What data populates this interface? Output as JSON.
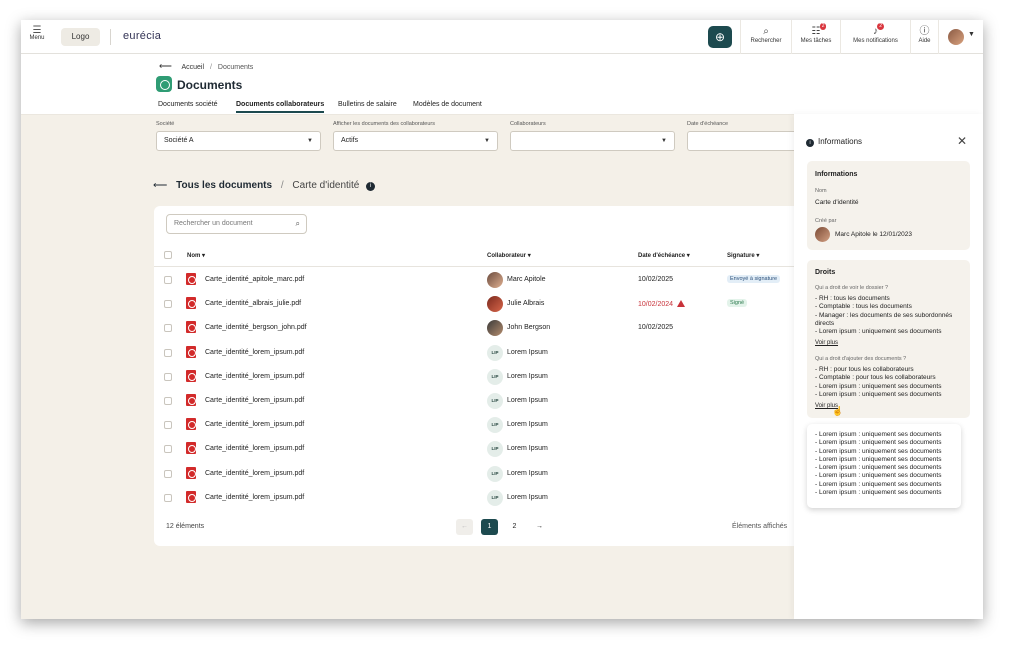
{
  "topbar": {
    "menu_label": "Menu",
    "logo_label": "Logo",
    "brand": "eurécia",
    "search_label": "Rechercher",
    "tasks_label": "Mes tâches",
    "tasks_badge": "2",
    "notifications_label": "Mes notifications",
    "notifications_badge": "2",
    "help_label": "Aide"
  },
  "breadcrumb": {
    "home": "Accueil",
    "separator": "/",
    "current": "Documents"
  },
  "page_title": "Documents",
  "tabs": [
    {
      "label": "Documents société",
      "active": false
    },
    {
      "label": "Documents collaborateurs",
      "active": true
    },
    {
      "label": "Bulletins de salaire",
      "active": false
    },
    {
      "label": "Modèles de document",
      "active": false
    }
  ],
  "filters": {
    "company": {
      "label": "Société",
      "value": "Société A"
    },
    "show_docs": {
      "label": "Afficher les documents des collaborateurs",
      "value": "Actifs"
    },
    "collaborators": {
      "label": "Collaborateurs",
      "value": ""
    },
    "due_date": {
      "label": "Date d'échéance",
      "value": ""
    }
  },
  "content": {
    "back_title": "Tous les documents",
    "separator": "/",
    "folder": "Carte d'identité"
  },
  "table": {
    "search_placeholder": "Rechercher un document",
    "headers": {
      "name": "Nom",
      "collaborator": "Collaborateur",
      "due": "Date d'échéance",
      "signature": "Signature"
    },
    "rows": [
      {
        "file": "Carte_identité_apitole_marc.pdf",
        "collaborator": "Marc Apitole",
        "initials": "",
        "due": "10/02/2025",
        "overdue": false,
        "signature": "Envoyé à signature"
      },
      {
        "file": "Carte_identité_albrais_julie.pdf",
        "collaborator": "Julie Albrais",
        "initials": "",
        "due": "10/02/2024",
        "overdue": true,
        "signature": "Signé"
      },
      {
        "file": "Carte_identité_bergson_john.pdf",
        "collaborator": "John Bergson",
        "initials": "",
        "due": "10/02/2025",
        "overdue": false,
        "signature": ""
      },
      {
        "file": "Carte_identité_lorem_ipsum.pdf",
        "collaborator": "Lorem Ipsum",
        "initials": "LIP",
        "due": "",
        "overdue": false,
        "signature": ""
      },
      {
        "file": "Carte_identité_lorem_ipsum.pdf",
        "collaborator": "Lorem Ipsum",
        "initials": "LIP",
        "due": "",
        "overdue": false,
        "signature": ""
      },
      {
        "file": "Carte_identité_lorem_ipsum.pdf",
        "collaborator": "Lorem Ipsum",
        "initials": "LIP",
        "due": "",
        "overdue": false,
        "signature": ""
      },
      {
        "file": "Carte_identité_lorem_ipsum.pdf",
        "collaborator": "Lorem Ipsum",
        "initials": "LIP",
        "due": "",
        "overdue": false,
        "signature": ""
      },
      {
        "file": "Carte_identité_lorem_ipsum.pdf",
        "collaborator": "Lorem Ipsum",
        "initials": "LIP",
        "due": "",
        "overdue": false,
        "signature": ""
      },
      {
        "file": "Carte_identité_lorem_ipsum.pdf",
        "collaborator": "Lorem Ipsum",
        "initials": "LIP",
        "due": "",
        "overdue": false,
        "signature": ""
      },
      {
        "file": "Carte_identité_lorem_ipsum.pdf",
        "collaborator": "Lorem Ipsum",
        "initials": "LIP",
        "due": "",
        "overdue": false,
        "signature": ""
      }
    ]
  },
  "pagination": {
    "count": "12 éléments",
    "pages": [
      "1",
      "2"
    ],
    "current": "1",
    "prev": "←",
    "next": "→",
    "per_page_label": "Éléments affichés"
  },
  "panel": {
    "title": "Informations",
    "info_section": {
      "heading": "Informations",
      "name_label": "Nom",
      "name_value": "Carte d'identité",
      "created_label": "Créé par",
      "created_value": "Marc Apitole le 12/01/2023"
    },
    "rights_section": {
      "heading": "Droits",
      "view_question": "Qui a droit de voir le dossier ?",
      "view_rights": [
        "- RH : tous les documents",
        "- Comptable : tous les documents",
        "- Manager : les documents de ses subordonnés directs",
        "- Lorem ipsum : uniquement ses documents"
      ],
      "view_more": "Voir plus",
      "add_question": "Qui a droit d'ajouter des documents ?",
      "add_rights": [
        "- RH : pour tous les collaborateurs",
        "- Comptable : pour tous les collaborateurs",
        "- Lorem ipsum : uniquement ses documents",
        "- Lorem ipsum : uniquement ses documents"
      ],
      "add_more": "Voir plus"
    },
    "popover_items": [
      "- Lorem ipsum : uniquement ses documents",
      "- Lorem ipsum : uniquement ses documents",
      "- Lorem ipsum : uniquement ses documents",
      "- Lorem ipsum : uniquement ses documents",
      "- Lorem ipsum : uniquement ses documents",
      "- Lorem ipsum : uniquement ses documents",
      "- Lorem ipsum : uniquement ses documents",
      "- Lorem ipsum : uniquement ses documents"
    ]
  },
  "colors": {
    "accent": "#1d4a4f",
    "danger": "#c8323a",
    "background": "#f4f0e8"
  }
}
